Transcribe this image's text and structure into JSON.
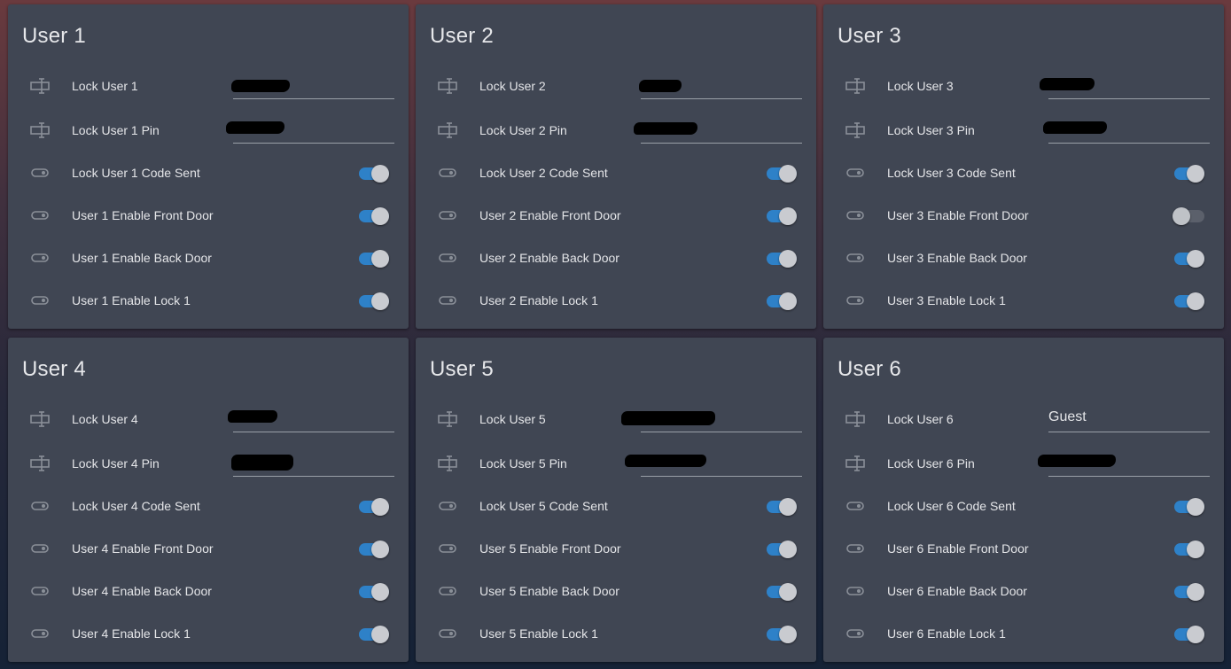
{
  "colors": {
    "card_background": "#404653",
    "toggle_on": "#2e81c8",
    "toggle_off": "#5b606b",
    "text": "#e4e5e8"
  },
  "cards": [
    {
      "title": "User 1",
      "lock_user_label": "Lock User 1",
      "lock_user_value": "",
      "lock_pin_label": "Lock User 1 Pin",
      "lock_pin_value": "",
      "code_sent_label": "Lock User 1 Code Sent",
      "code_sent": true,
      "front_door_label": "User 1 Enable Front Door",
      "front_door": true,
      "back_door_label": "User 1 Enable Back Door",
      "back_door": true,
      "lock1_label": "User 1 Enable Lock 1",
      "lock1": true
    },
    {
      "title": "User 2",
      "lock_user_label": "Lock User 2",
      "lock_user_value": "",
      "lock_pin_label": "Lock User 2 Pin",
      "lock_pin_value": "",
      "code_sent_label": "Lock User 2 Code Sent",
      "code_sent": true,
      "front_door_label": "User 2 Enable Front Door",
      "front_door": true,
      "back_door_label": "User 2 Enable Back Door",
      "back_door": true,
      "lock1_label": "User 2 Enable Lock 1",
      "lock1": true
    },
    {
      "title": "User 3",
      "lock_user_label": "Lock User 3",
      "lock_user_value": "",
      "lock_pin_label": "Lock User 3 Pin",
      "lock_pin_value": "",
      "code_sent_label": "Lock User 3 Code Sent",
      "code_sent": true,
      "front_door_label": "User 3 Enable Front Door",
      "front_door": false,
      "back_door_label": "User 3 Enable Back Door",
      "back_door": true,
      "lock1_label": "User 3 Enable Lock 1",
      "lock1": true
    },
    {
      "title": "User 4",
      "lock_user_label": "Lock User 4",
      "lock_user_value": "",
      "lock_pin_label": "Lock User 4 Pin",
      "lock_pin_value": "",
      "code_sent_label": "Lock User 4 Code Sent",
      "code_sent": true,
      "front_door_label": "User 4 Enable Front Door",
      "front_door": true,
      "back_door_label": "User 4 Enable Back Door",
      "back_door": true,
      "lock1_label": "User 4 Enable Lock 1",
      "lock1": true
    },
    {
      "title": "User 5",
      "lock_user_label": "Lock User 5",
      "lock_user_value": "",
      "lock_pin_label": "Lock User 5 Pin",
      "lock_pin_value": "",
      "code_sent_label": "Lock User 5 Code Sent",
      "code_sent": true,
      "front_door_label": "User 5 Enable Front Door",
      "front_door": true,
      "back_door_label": "User 5 Enable Back Door",
      "back_door": true,
      "lock1_label": "User 5 Enable Lock 1",
      "lock1": true
    },
    {
      "title": "User 6",
      "lock_user_label": "Lock User 6",
      "lock_user_value": "Guest",
      "lock_pin_label": "Lock User 6 Pin",
      "lock_pin_value": "",
      "code_sent_label": "Lock User 6 Code Sent",
      "code_sent": true,
      "front_door_label": "User 6 Enable Front Door",
      "front_door": true,
      "back_door_label": "User 6 Enable Back Door",
      "back_door": true,
      "lock1_label": "User 6 Enable Lock 1",
      "lock1": true
    }
  ]
}
